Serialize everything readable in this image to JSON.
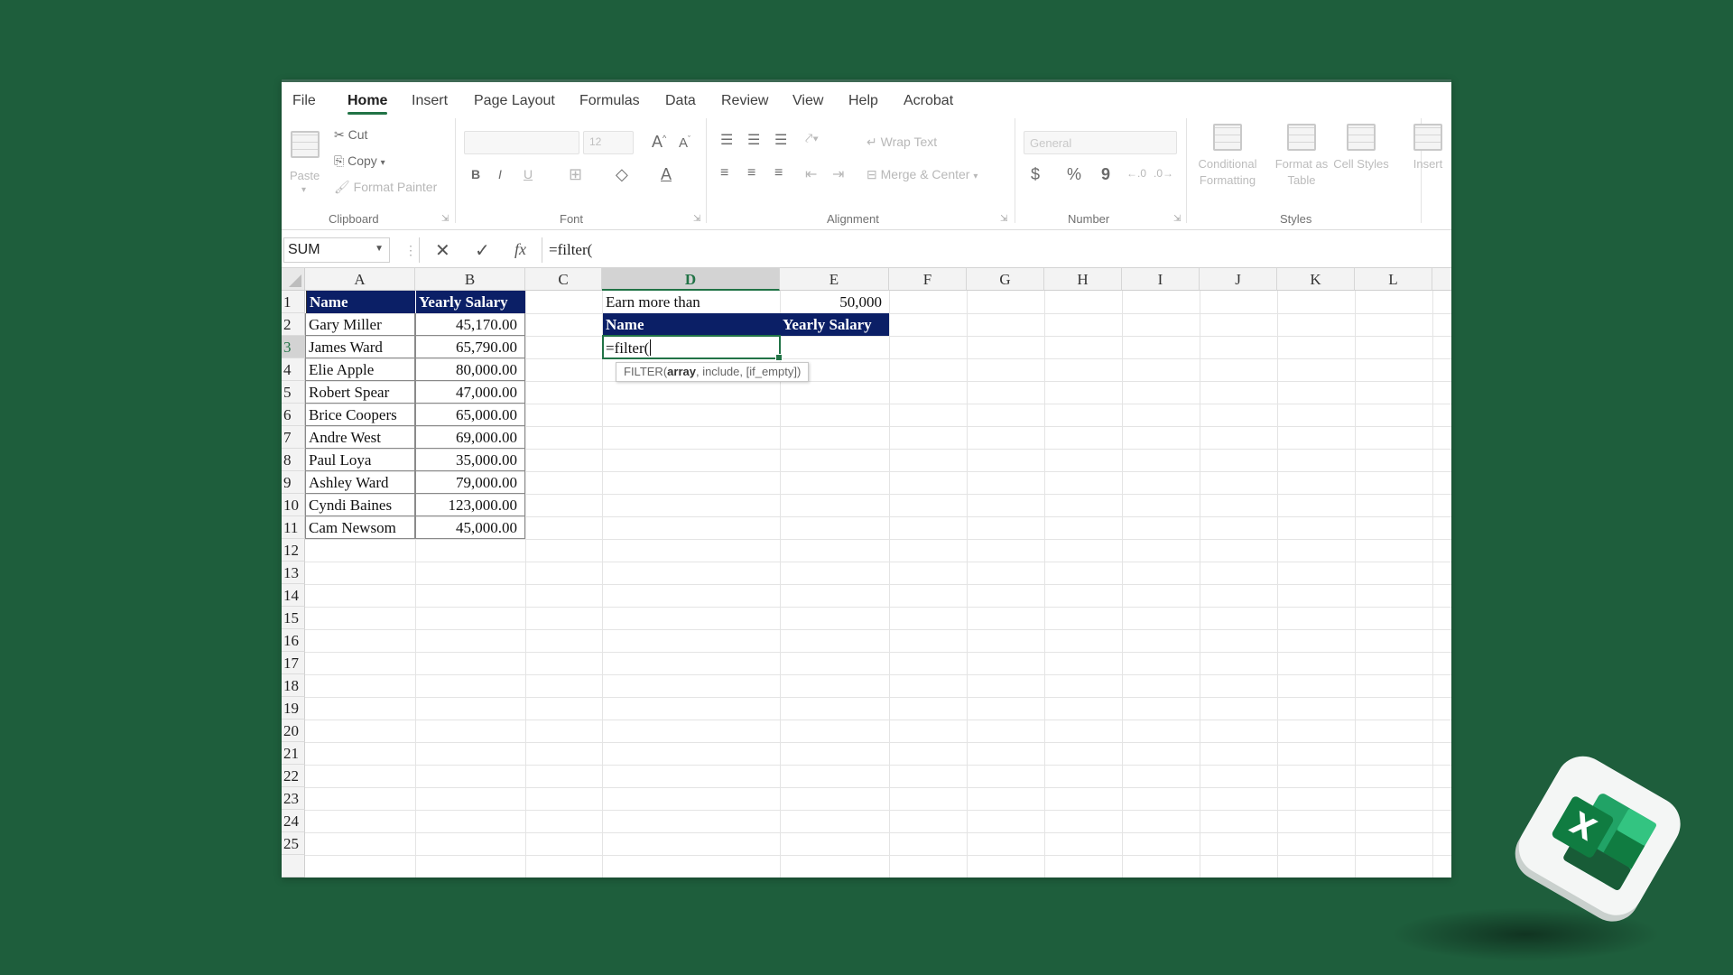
{
  "colors": {
    "background": "#1e5e3c",
    "accent": "#217346",
    "table_header_fill": "#0b1f66"
  },
  "menu": {
    "tabs": [
      "File",
      "Home",
      "Insert",
      "Page Layout",
      "Formulas",
      "Data",
      "Review",
      "View",
      "Help",
      "Acrobat"
    ],
    "active": "Home"
  },
  "ribbon": {
    "clipboard": {
      "paste": "Paste",
      "cut": "Cut",
      "copy": "Copy",
      "format_painter": "Format Painter",
      "label": "Clipboard"
    },
    "font": {
      "size": "12",
      "label": "Font",
      "bold": "B",
      "italic": "I",
      "underline": "U",
      "font_color": "A"
    },
    "alignment": {
      "wrap_text": "Wrap Text",
      "merge_center": "Merge & Center",
      "label": "Alignment"
    },
    "number": {
      "format": "General",
      "currency": "$",
      "percent": "%",
      "comma": "9",
      "label": "Number"
    },
    "styles": {
      "conditional_formatting": "Conditional Formatting",
      "format_as_table": "Format as Table",
      "cell_styles": "Cell Styles",
      "label": "Styles"
    },
    "cells": {
      "insert": "Insert"
    }
  },
  "formula_bar": {
    "name_box": "SUM",
    "formula": "=filter(",
    "fx": "fx"
  },
  "sheet": {
    "columns": [
      "A",
      "B",
      "C",
      "D",
      "E",
      "F",
      "G",
      "H",
      "I",
      "J",
      "K",
      "L"
    ],
    "rows": [
      "1",
      "2",
      "3",
      "4",
      "5",
      "6",
      "7",
      "8",
      "9",
      "10",
      "11",
      "12",
      "13",
      "14",
      "15",
      "16",
      "17",
      "18",
      "19",
      "20",
      "21",
      "22",
      "23",
      "24",
      "25"
    ],
    "selected_column": "D",
    "selected_row": "3",
    "table_headers": {
      "name": "Name",
      "salary": "Yearly Salary"
    },
    "employees": [
      {
        "name": "Gary Miller",
        "salary": "45,170.00"
      },
      {
        "name": "James Ward",
        "salary": "65,790.00"
      },
      {
        "name": "Elie Apple",
        "salary": "80,000.00"
      },
      {
        "name": "Robert Spear",
        "salary": "47,000.00"
      },
      {
        "name": "Brice Coopers",
        "salary": "65,000.00"
      },
      {
        "name": "Andre West",
        "salary": "69,000.00"
      },
      {
        "name": "Paul Loya",
        "salary": "35,000.00"
      },
      {
        "name": "Ashley Ward",
        "salary": "79,000.00"
      },
      {
        "name": "Cyndi Baines",
        "salary": "123,000.00"
      },
      {
        "name": "Cam Newsom",
        "salary": "45,000.00"
      }
    ],
    "criteria_label": "Earn more than",
    "criteria_value": "50,000",
    "result_headers": {
      "name": "Name",
      "salary": "Yearly Salary"
    },
    "editing_cell_text": "=filter(",
    "tooltip": {
      "func": "FILTER(",
      "bold_arg": "array",
      "rest": ", include, [if_empty])"
    }
  }
}
